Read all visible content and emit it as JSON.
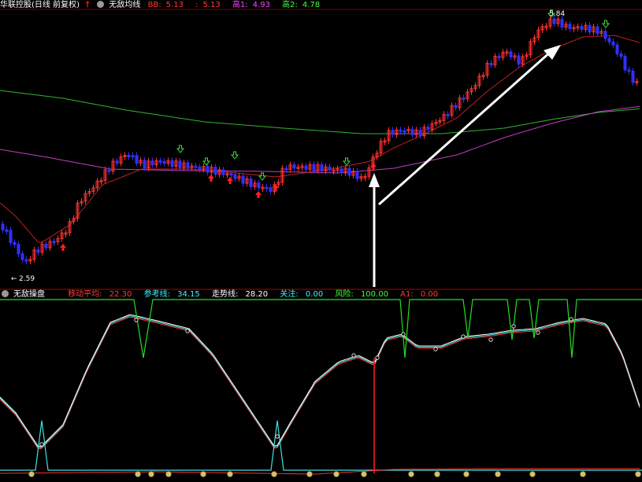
{
  "top_header": {
    "security": "华联控股(日线 前复权)",
    "indicator": "无敌均线",
    "items": [
      {
        "label": "BB:",
        "value": "5.13",
        "color": "#ff3b3b"
      },
      {
        "label": ":",
        "value": "5.13",
        "color": "#ff3b3b"
      },
      {
        "label": "高1:",
        "value": "4.93",
        "color": "#ff40ff"
      },
      {
        "label": "高2:",
        "value": "4.78",
        "color": "#40ff40"
      }
    ]
  },
  "price_chart": {
    "high_label": "5.84",
    "low_label": "2.59"
  },
  "bottom_header": {
    "indicator": "无敌操盘",
    "items": [
      {
        "label": "移动平均:",
        "value": "22.30",
        "color": "#ff3b3b"
      },
      {
        "label": "参考线:",
        "value": "34.15",
        "color": "#3ff0ff"
      },
      {
        "label": "走势线:",
        "value": "28.20",
        "color": "#ffffff"
      },
      {
        "label": "关注:",
        "value": "0.00",
        "color": "#3ff0ff"
      },
      {
        "label": "风险:",
        "value": "100.00",
        "color": "#40ff40"
      },
      {
        "label": "A1:",
        "value": "0.00",
        "color": "#ff3b3b"
      }
    ]
  },
  "colors": {
    "up": "#ff3030",
    "down": "#3030ff",
    "ma_long": "#2fb52f",
    "ma_mid": "#c040c0",
    "ma_short": "#c02020",
    "osc_white": "#ffffff",
    "osc_cyan": "#40e0e0",
    "osc_red": "#ff3030",
    "risk": "#20e020"
  }
}
